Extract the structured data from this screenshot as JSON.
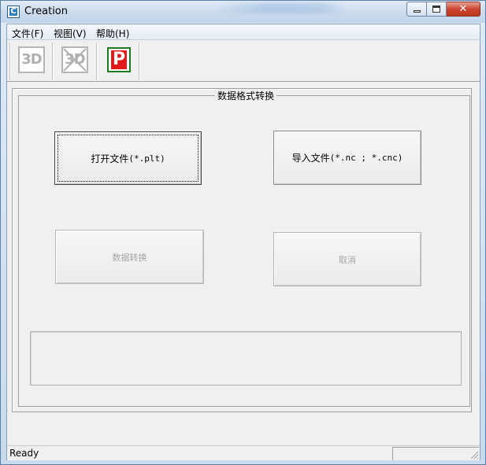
{
  "window": {
    "title": "Creation",
    "app_icon": "app-logo-icon",
    "app_icon_letter": "C"
  },
  "caption": {
    "minimize": "minimize-icon",
    "maximize": "maximize-icon",
    "close": "close-icon",
    "close_glyph": "✕"
  },
  "menu": {
    "file": "文件(F)",
    "view": "视图(V)",
    "help": "帮助(H)"
  },
  "toolbar": {
    "btn_3d_label": "3D",
    "btn_3d_off_label": "3D",
    "btn_p_label": "P"
  },
  "group": {
    "title": "数据格式转换"
  },
  "buttons": {
    "open_prefix": "打开文件",
    "open_suffix": "(*.plt)",
    "import_prefix": "导入文件",
    "import_suffix": "(*.nc ; *.cnc)",
    "convert": "数据转换",
    "cancel": "取消"
  },
  "statusbar": {
    "text": "Ready"
  },
  "colors": {
    "p_icon_red": "#e31a1a",
    "p_icon_border_green": "#1e7a1e",
    "close_button_red": "#c9452f"
  }
}
